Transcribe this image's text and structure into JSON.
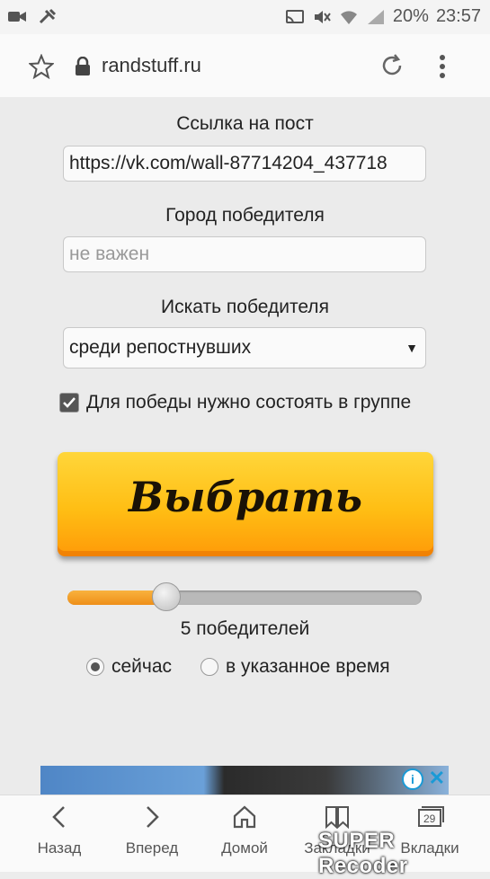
{
  "status_bar": {
    "battery": "20%",
    "time": "23:57",
    "icons": [
      "video-icon",
      "tools-icon",
      "cast-icon",
      "mute-icon",
      "wifi-icon",
      "signal-icon"
    ]
  },
  "browser": {
    "url": "randstuff.ru"
  },
  "form": {
    "post_link_label": "Ссылка на пост",
    "post_link_value": "https://vk.com/wall-87714204_437718",
    "city_label": "Город победителя",
    "city_placeholder": "не важен",
    "search_label": "Искать победителя",
    "search_value": "среди репостнувших",
    "group_checkbox_label": "Для победы нужно состоять в группе",
    "group_checkbox_checked": true,
    "choose_button": "Выбрать",
    "winners_slider_fraction": 0.28,
    "winners_text": "5 победителей",
    "radio_now": "сейчас",
    "radio_scheduled": "в указанное время",
    "radio_selected": "now"
  },
  "ad": {
    "info_glyph": "i",
    "close_glyph": "✕"
  },
  "bottom_nav": {
    "back": "Назад",
    "forward": "Вперед",
    "home": "Домой",
    "bookmarks": "Закладки",
    "tabs": "Вкладки",
    "tabs_count": "29"
  },
  "watermark": "SUPER Recoder",
  "colors": {
    "accent_orange": "#ffbe14",
    "slider_fill": "#ee8f18",
    "ad_blue": "#1a9ad6"
  }
}
